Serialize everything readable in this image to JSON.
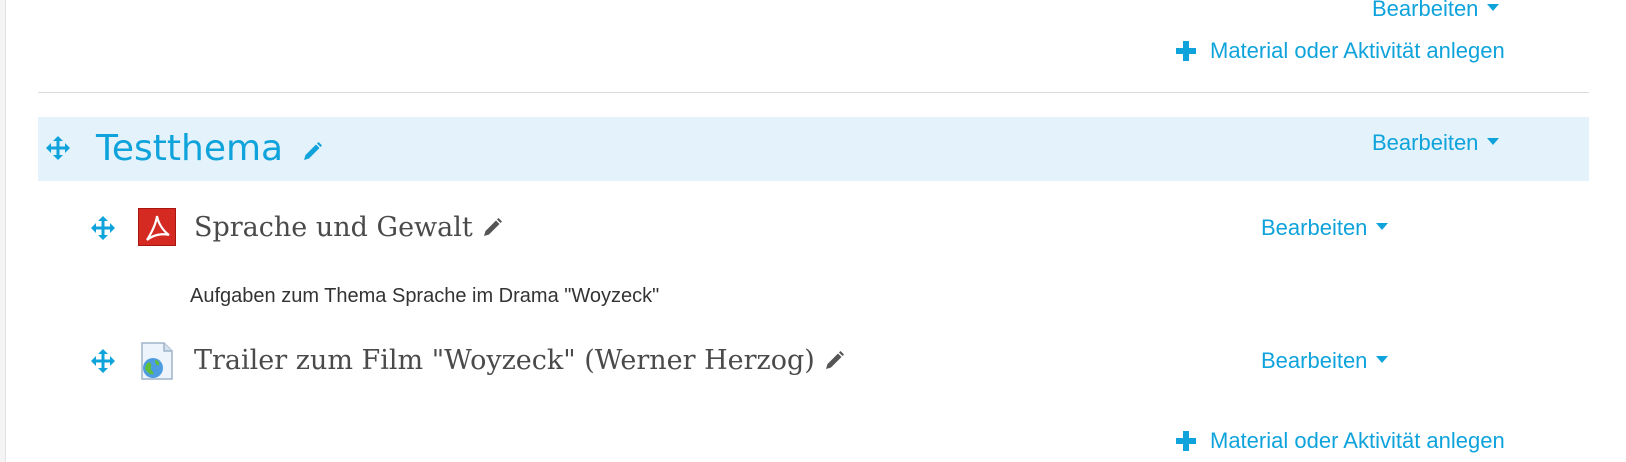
{
  "top": {
    "edit_label": "Bearbeiten",
    "add_label": "Material oder Aktivität anlegen"
  },
  "section": {
    "title": "Testthema",
    "edit_label": "Bearbeiten"
  },
  "activities": [
    {
      "title": "Sprache und Gewalt",
      "type_icon": "pdf-icon",
      "edit_label": "Bearbeiten",
      "description": "Aufgaben zum Thema Sprache im Drama \"Woyzeck\""
    },
    {
      "title": "Trailer zum Film \"Woyzeck\" (Werner Herzog)",
      "type_icon": "url-icon",
      "edit_label": "Bearbeiten"
    }
  ],
  "bottom": {
    "add_label": "Material oder Aktivität anlegen"
  },
  "colors": {
    "accent": "#0fa3dc",
    "section_bg": "#e3f2fb",
    "text": "#4a4a4a"
  }
}
